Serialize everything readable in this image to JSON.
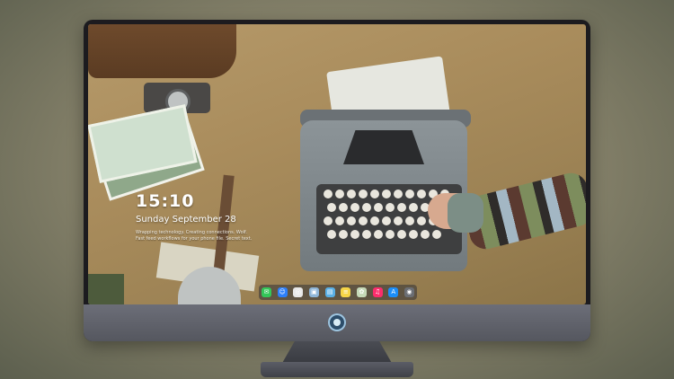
{
  "lockscreen": {
    "time": "15:10",
    "date": "Sunday September 28",
    "notification_lines": [
      "Wrapping technology. Creating connections. Wolf.",
      "Fast feed workflows for your phone file. Secret text."
    ]
  },
  "dock": {
    "apps": [
      {
        "name": "messages-icon",
        "color": "#34c759",
        "glyph": "✉"
      },
      {
        "name": "finder-icon",
        "color": "#2d7ff9",
        "glyph": "☺"
      },
      {
        "name": "safari-icon",
        "color": "#e8e8e8",
        "glyph": "◎"
      },
      {
        "name": "preview-icon",
        "color": "#8fb6d8",
        "glyph": "▣"
      },
      {
        "name": "claquette-icon",
        "color": "#5ab0e6",
        "glyph": "▤"
      },
      {
        "name": "notes-icon",
        "color": "#f5d547",
        "glyph": "≡"
      },
      {
        "name": "photos-icon",
        "color": "#c6d9b8",
        "glyph": "✿"
      },
      {
        "name": "music-icon",
        "color": "#fa2d6c",
        "glyph": "♫"
      },
      {
        "name": "appstore-icon",
        "color": "#1c8ef9",
        "glyph": "A"
      },
      {
        "name": "screenshot-icon",
        "color": "#6b6e74",
        "glyph": "◉"
      }
    ]
  },
  "colors": {
    "bezel": "#1c1b1f",
    "chin": "#5f6169",
    "background": "#8a856d"
  }
}
